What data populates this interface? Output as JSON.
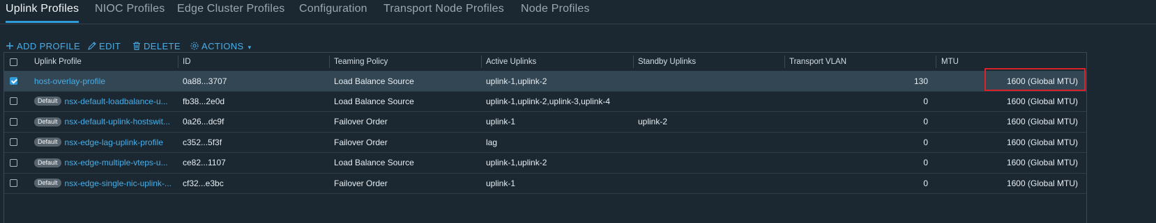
{
  "tabs": [
    {
      "label": "Uplink Profiles",
      "active": true
    },
    {
      "label": "NIOC Profiles"
    },
    {
      "label": "Edge Cluster Profiles"
    },
    {
      "label": "Configuration"
    },
    {
      "label": "Transport Node Profiles"
    },
    {
      "label": "Node Profiles"
    }
  ],
  "toolbar": {
    "add_label": "ADD PROFILE",
    "edit_label": "EDIT",
    "delete_label": "DELETE",
    "actions_label": "ACTIONS"
  },
  "table": {
    "columns": [
      "Uplink Profile",
      "ID",
      "Teaming Policy",
      "Active Uplinks",
      "Standby Uplinks",
      "Transport VLAN",
      "MTU"
    ],
    "default_badge": "Default",
    "rows": [
      {
        "selected": true,
        "default": false,
        "name": "host-overlay-profile",
        "id": "0a88...3707",
        "teaming": "Load Balance Source",
        "active": "uplink-1,uplink-2",
        "standby": "",
        "vlan": "130",
        "mtu": "1600 (Global MTU)"
      },
      {
        "selected": false,
        "default": true,
        "name": "nsx-default-loadbalance-u...",
        "id": "fb38...2e0d",
        "teaming": "Load Balance Source",
        "active": "uplink-1,uplink-2,uplink-3,uplink-4",
        "standby": "",
        "vlan": "0",
        "mtu": "1600 (Global MTU)"
      },
      {
        "selected": false,
        "default": true,
        "name": "nsx-default-uplink-hostswit...",
        "id": "0a26...dc9f",
        "teaming": "Failover Order",
        "active": "uplink-1",
        "standby": "uplink-2",
        "vlan": "0",
        "mtu": "1600 (Global MTU)"
      },
      {
        "selected": false,
        "default": true,
        "name": "nsx-edge-lag-uplink-profile",
        "id": "c352...5f3f",
        "teaming": "Failover Order",
        "active": "lag",
        "standby": "",
        "vlan": "0",
        "mtu": "1600 (Global MTU)"
      },
      {
        "selected": false,
        "default": true,
        "name": "nsx-edge-multiple-vteps-u...",
        "id": "ce82...1107",
        "teaming": "Load Balance Source",
        "active": "uplink-1,uplink-2",
        "standby": "",
        "vlan": "0",
        "mtu": "1600 (Global MTU)"
      },
      {
        "selected": false,
        "default": true,
        "name": "nsx-edge-single-nic-uplink-...",
        "id": "cf32...e3bc",
        "teaming": "Failover Order",
        "active": "uplink-1",
        "standby": "",
        "vlan": "0",
        "mtu": "1600 (Global MTU)"
      }
    ]
  },
  "colors": {
    "accent": "#49aee7",
    "highlight": "#d8232a",
    "selected_row": "#324654"
  }
}
